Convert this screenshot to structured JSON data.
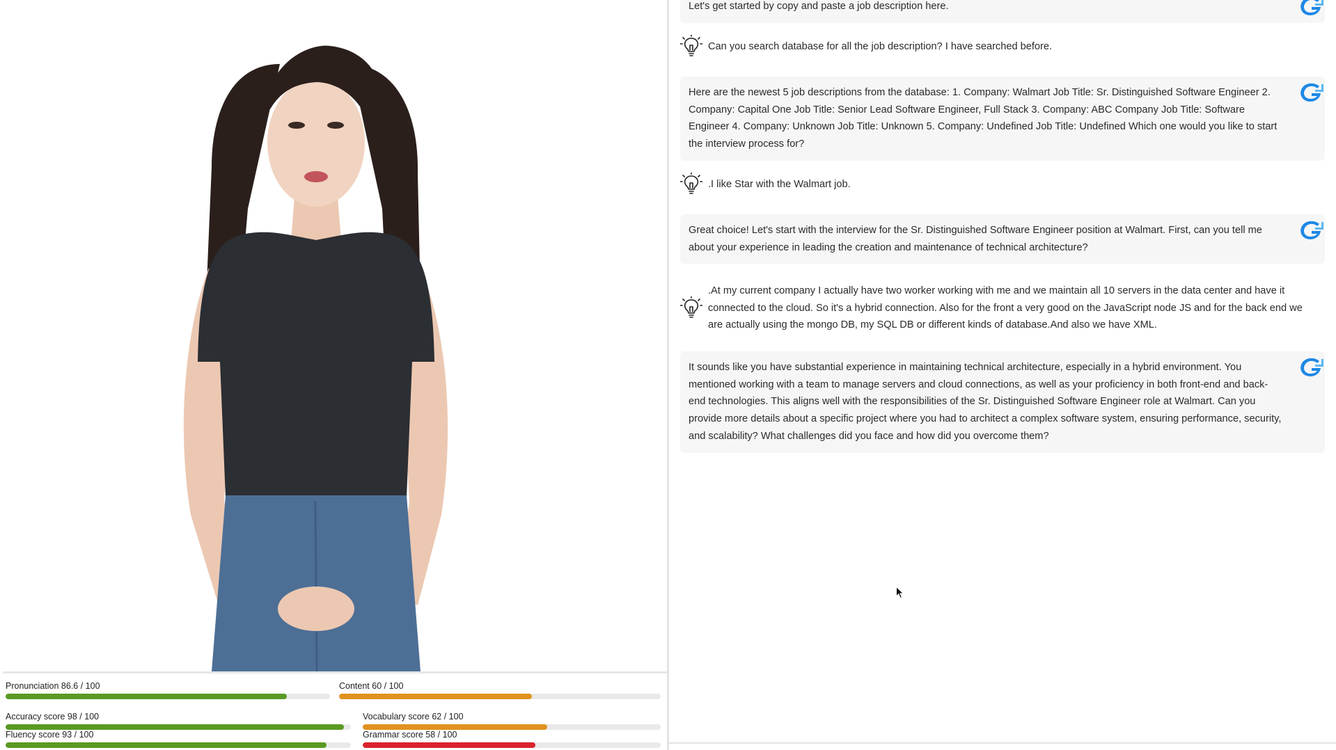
{
  "scores": {
    "pronunciation": {
      "label": "Pronunciation 86.6 / 100",
      "value": 86.6,
      "max": 100,
      "color": "#5a9a22"
    },
    "content": {
      "label": "Content 60 / 100",
      "value": 60,
      "max": 100,
      "color": "#e0921f"
    },
    "accuracy": {
      "label": "Accuracy score 98 / 100",
      "value": 98,
      "max": 100,
      "color": "#5a9a22"
    },
    "vocabulary": {
      "label": "Vocabulary score 62 / 100",
      "value": 62,
      "max": 100,
      "color": "#e0921f"
    },
    "fluency": {
      "label": "Fluency score 93 / 100",
      "value": 93,
      "max": 100,
      "color": "#5a9a22"
    },
    "grammar": {
      "label": "Grammar score 58 / 100",
      "value": 58,
      "max": 100,
      "color": "#d9232d"
    }
  },
  "chat": {
    "messages": [
      {
        "role": "ai",
        "icon": "ai-logo-icon",
        "text": "Let's get started by copy and paste a job description here."
      },
      {
        "role": "user",
        "icon": "lightbulb-icon",
        "text": "Can you search database for all the job description? I have searched before."
      },
      {
        "role": "ai",
        "icon": "ai-logo-icon",
        "text": "Here are the newest 5 job descriptions from the database: 1. Company: Walmart Job Title: Sr. Distinguished Software Engineer 2. Company: Capital One Job Title: Senior Lead Software Engineer, Full Stack 3. Company: ABC Company Job Title: Software Engineer 4. Company: Unknown Job Title: Unknown 5. Company: Undefined Job Title: Undefined Which one would you like to start the interview process for?"
      },
      {
        "role": "user",
        "icon": "lightbulb-icon",
        "text": ".I like Star with the Walmart job."
      },
      {
        "role": "ai",
        "icon": "ai-logo-icon",
        "text": "Great choice! Let's start with the interview for the Sr. Distinguished Software Engineer position at Walmart. First, can you tell me about your experience in leading the creation and maintenance of technical architecture?"
      },
      {
        "role": "user",
        "icon": "lightbulb-icon",
        "text": ".At my current company I actually have two worker working with me and we maintain all 10 servers in the data center and have it connected to the cloud. So it's a hybrid connection. Also for the front a very good on the JavaScript node JS and for the back end we are actually using the mongo DB, my SQL DB or different kinds of database.And also we have XML."
      },
      {
        "role": "ai",
        "icon": "ai-logo-icon",
        "text": "It sounds like you have substantial experience in maintaining technical architecture, especially in a hybrid environment. You mentioned working with a team to manage servers and cloud connections, as well as your proficiency in both front-end and back-end technologies. This aligns well with the responsibilities of the Sr. Distinguished Software Engineer role at Walmart. Can you provide more details about a specific project where you had to architect a complex software system, ensuring performance, security, and scalability? What challenges did you face and how did you overcome them?"
      }
    ]
  },
  "colors": {
    "ai_bubble_bg": "#f6f6f7",
    "logo_blue": "#1e88e5",
    "logo_light_blue": "#5cb8f2",
    "shirt": "#2b2e33",
    "jeans": "#4d6f96"
  }
}
